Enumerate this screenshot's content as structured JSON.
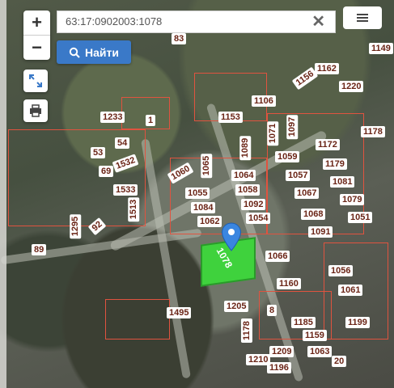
{
  "search": {
    "query": "63:17:0902003:1078",
    "button_label": "Найти"
  },
  "zoom": {
    "in_label": "+",
    "out_label": "−"
  },
  "selected_parcel": {
    "label": "1078"
  },
  "parcel_labels": [
    "83",
    "1149",
    "1156",
    "1162",
    "1220",
    "1106",
    "1153",
    "1233",
    "1",
    "1097",
    "1071",
    "1178",
    "54",
    "1059",
    "1172",
    "53",
    "1532",
    "1060",
    "1065",
    "1089",
    "1057",
    "1179",
    "69",
    "1064",
    "1081",
    "1533",
    "1055",
    "1058",
    "1067",
    "1079",
    "1084",
    "1092",
    "1062",
    "1054",
    "1068",
    "1051",
    "1091",
    "1513",
    "89",
    "1295",
    "92",
    "1066",
    "1056",
    "1061",
    "1160",
    "1495",
    "8",
    "1185",
    "1199",
    "1205",
    "1178",
    "1159",
    "1210",
    "1209",
    "1063",
    "1196",
    "20"
  ],
  "colors": {
    "parcel_border": "#e0533f",
    "selected_fill": "#3fd23d",
    "accent": "#3a79c8"
  },
  "icons": [
    "search-icon",
    "close-icon",
    "menu-icon",
    "expand-icon",
    "print-icon",
    "location-pin-icon"
  ]
}
